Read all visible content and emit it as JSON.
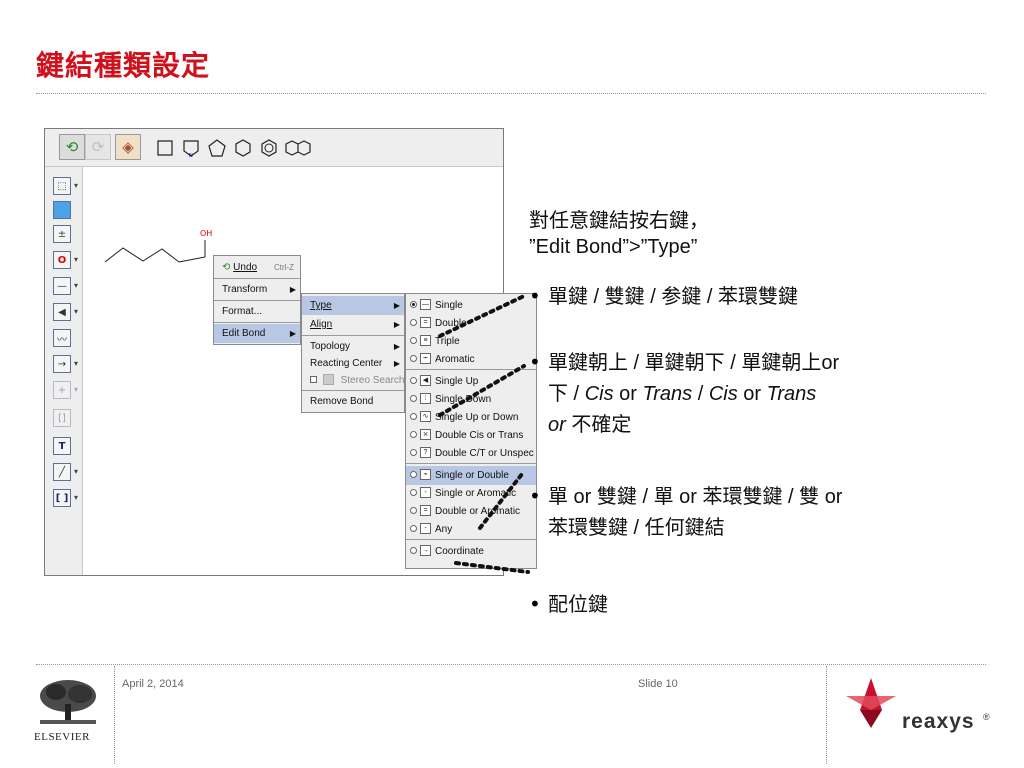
{
  "slide": {
    "title": "鍵結種類設定",
    "footer_date": "April 2, 2014",
    "footer_slide": "Slide 10",
    "publisher_logo_text": "ELSEVIER",
    "brand_logo_text": "reaxys",
    "brand_registered": "®"
  },
  "canvas": {
    "atom_label": "OH"
  },
  "context_menu": {
    "items": [
      {
        "label": "Undo",
        "shortcut": "Ctrl-Z"
      },
      {
        "label": "Transform"
      },
      {
        "label": "Format..."
      },
      {
        "label": "Edit Bond"
      }
    ]
  },
  "edit_bond_menu": {
    "items": [
      {
        "label": "Type"
      },
      {
        "label": "Align"
      },
      {
        "label": "Topology"
      },
      {
        "label": "Reacting Center"
      },
      {
        "label": "Stereo Search"
      },
      {
        "label": "Remove Bond"
      }
    ]
  },
  "type_menu": {
    "items": [
      {
        "label": "Single",
        "icon": "—"
      },
      {
        "label": "Double",
        "icon": "="
      },
      {
        "label": "Triple",
        "icon": "≡"
      },
      {
        "label": "Aromatic",
        "icon": "┅"
      },
      {
        "label": "Single Up",
        "icon": "◀"
      },
      {
        "label": "Single Down",
        "icon": "⦙"
      },
      {
        "label": "Single Up or Down",
        "icon": "∿"
      },
      {
        "label": "Double Cis or Trans",
        "icon": "⨯"
      },
      {
        "label": "Double C/T or Unspec",
        "icon": "?"
      },
      {
        "label": "Single or Double",
        "icon": "⌁"
      },
      {
        "label": "Single or Aromatic",
        "icon": "-"
      },
      {
        "label": "Double or Aromatic",
        "icon": "="
      },
      {
        "label": "Any",
        "icon": "-"
      },
      {
        "label": "Coordinate",
        "icon": "→"
      }
    ],
    "selected": "Single"
  },
  "notes": {
    "intro_line1": "對任意鍵結按右鍵，",
    "intro_line2": "”Edit Bond”>”Type”",
    "bullet1": "單鍵 / 雙鍵 / 参鍵 / 苯環雙鍵",
    "bullet2_line1": "單鍵朝上 / 單鍵朝下 / 單鍵朝上or",
    "bullet2_line2_a": "下 /",
    "bullet2_cis1": "Cis",
    "bullet2_or1": "or",
    "bullet2_trans1": "Trans",
    "bullet2_slash": "/",
    "bullet2_cis2": "Cis",
    "bullet2_or2": "or",
    "bullet2_trans2": "Trans",
    "bullet2_line3_or": "or",
    "bullet2_line3_b": "不確定",
    "bullet3_line1": "單 or 雙鍵 / 單 or 苯環雙鍵 / 雙 or",
    "bullet3_line2": "苯環雙鍵 / 任何鍵結",
    "bullet4": "配位鍵"
  },
  "colors": {
    "title": "#d0101b",
    "menu_highlight": "#b8c8e4",
    "reaxys_red": "#c8102e"
  }
}
